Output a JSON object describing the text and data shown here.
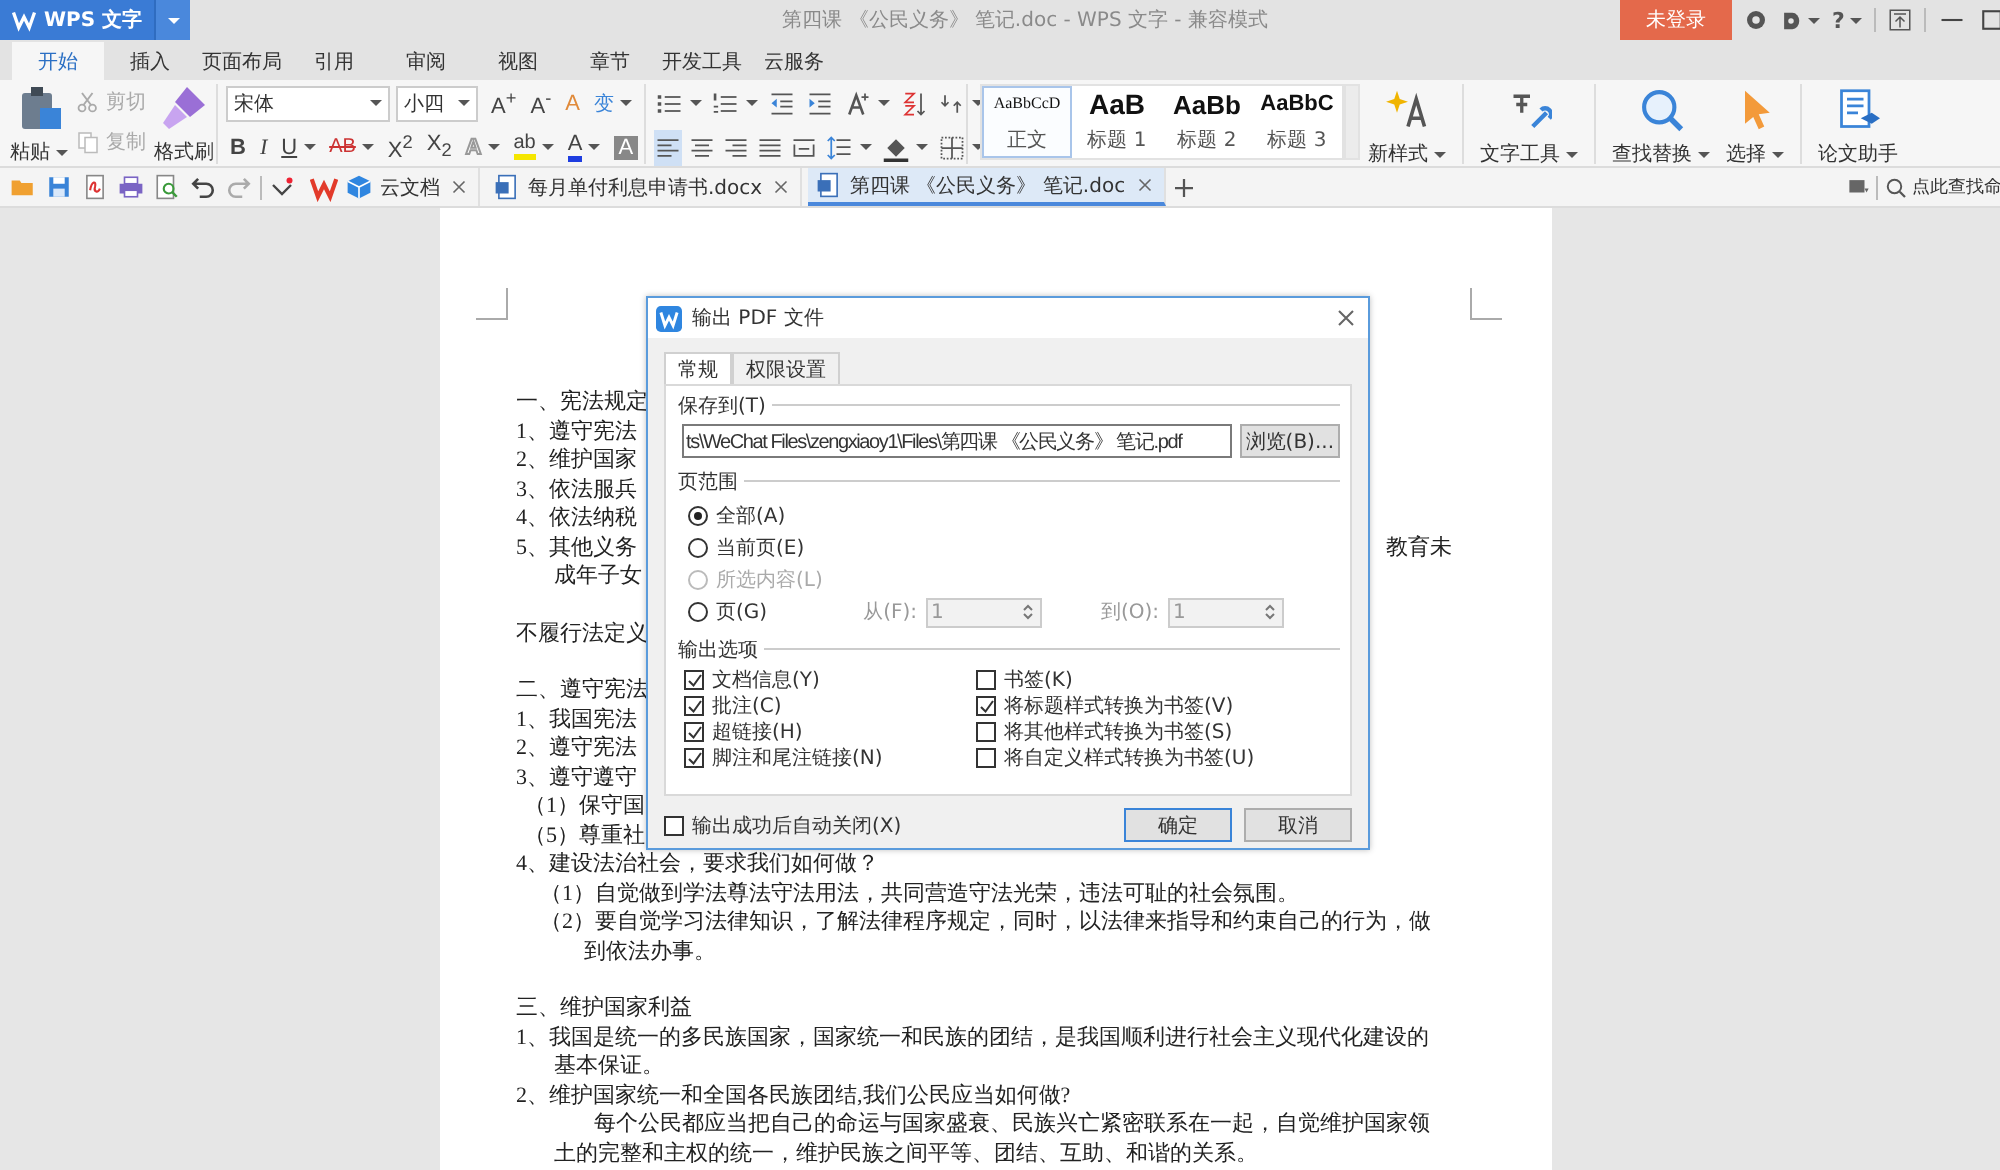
{
  "window": {
    "app_button": "WPS 文字",
    "title": "第四课 《公民义务》 笔记.doc - WPS 文字 - 兼容模式",
    "login_button": "未登录",
    "help_glyph": "?"
  },
  "ribbon_tabs": [
    {
      "label": "开始",
      "selected": true
    },
    {
      "label": "插入",
      "selected": false
    },
    {
      "label": "页面布局",
      "selected": false
    },
    {
      "label": "引用",
      "selected": false
    },
    {
      "label": "审阅",
      "selected": false
    },
    {
      "label": "视图",
      "selected": false
    },
    {
      "label": "章节",
      "selected": false
    },
    {
      "label": "开发工具",
      "selected": false
    },
    {
      "label": "云服务",
      "selected": false
    }
  ],
  "ribbon": {
    "paste": "粘贴",
    "cut": {
      "label": "剪切",
      "disabled": true
    },
    "copy": {
      "label": "复制",
      "disabled": true
    },
    "format_painter": "格式刷",
    "font_name": "宋体",
    "font_size": "小四",
    "font_row1": [
      {
        "glyph": "A$^{+}$",
        "kind": "plain",
        "dropdown": false
      },
      {
        "glyph": "A$^{-}$",
        "kind": "plain",
        "dropdown": false
      },
      {
        "glyph": "A",
        "kind": "clear",
        "dropdown": false
      },
      {
        "glyph": "变",
        "kind": "phonetic",
        "dropdown": true
      }
    ],
    "font_row2": [
      {
        "glyph": "B",
        "kind": "bold",
        "dropdown": false
      },
      {
        "glyph": "I",
        "kind": "italic",
        "dropdown": false
      },
      {
        "glyph": "U",
        "kind": "underline",
        "dropdown": true
      },
      {
        "glyph": "AB",
        "kind": "strike",
        "dropdown": true
      },
      {
        "glyph": "X$^{2}$",
        "kind": "plain",
        "dropdown": false
      },
      {
        "glyph": "X$_{2}$",
        "kind": "plain",
        "dropdown": false
      },
      {
        "glyph": "A",
        "kind": "outline",
        "dropdown": true
      },
      {
        "glyph": "ab",
        "kind": "highlight",
        "dropdown": true
      },
      {
        "glyph": "A",
        "kind": "color",
        "dropdown": true
      },
      {
        "glyph": "A",
        "kind": "shade",
        "dropdown": false
      }
    ],
    "align_buttons": [
      {
        "kind": "left",
        "selected": true
      },
      {
        "kind": "center",
        "selected": false
      },
      {
        "kind": "right",
        "selected": false
      },
      {
        "kind": "justify",
        "selected": false
      },
      {
        "kind": "distributed",
        "selected": false
      }
    ],
    "styles": [
      {
        "preview": "AaBbCcD",
        "label": "正文",
        "kind": "body",
        "selected": true
      },
      {
        "preview": "AaB",
        "label": "标题 1",
        "kind": "h1",
        "selected": false
      },
      {
        "preview": "AaBb",
        "label": "标题 2",
        "kind": "h2",
        "selected": false
      },
      {
        "preview": "AaBbC",
        "label": "标题 3",
        "kind": "h3",
        "selected": false
      }
    ],
    "tools": [
      {
        "label": "新样式",
        "kind": "new-style",
        "dropdown": true
      },
      {
        "label": "文字工具",
        "kind": "text-tools",
        "dropdown": true
      },
      {
        "label": "查找替换",
        "kind": "find",
        "dropdown": true
      },
      {
        "label": "选择",
        "kind": "select",
        "dropdown": true
      },
      {
        "label": "论文助手",
        "kind": "paper",
        "dropdown": false
      }
    ]
  },
  "doc_tabs": [
    {
      "label": "云文档",
      "kind": "cloud",
      "selected": false
    },
    {
      "label": "每月单付利息申请书.docx",
      "kind": "doc",
      "selected": false
    },
    {
      "label": "第四课 《公民义务》 笔记.doc",
      "kind": "doc",
      "selected": true
    }
  ],
  "command_search": {
    "placeholder": "点此查找命"
  },
  "document": {
    "lines": [
      {
        "text": "一、宪法规定",
        "kind": "section"
      },
      {
        "text": "1、遵守宪法",
        "kind": "item"
      },
      {
        "text": "2、维护国家",
        "kind": "item"
      },
      {
        "text": "3、依法服兵",
        "kind": "item"
      },
      {
        "text": "4、依法纳税",
        "kind": "item"
      },
      {
        "text": "5、其他义务",
        "tail": "教育未",
        "kind": "item"
      },
      {
        "text": "成年子女",
        "kind": "cont"
      },
      {
        "text": "不履行法定义",
        "kind": "note"
      },
      {
        "text": "二、遵守宪法",
        "kind": "section"
      },
      {
        "text": "1、我国宪法",
        "kind": "item"
      },
      {
        "text": "2、遵守宪法",
        "kind": "item"
      },
      {
        "text": "3、遵守遵守",
        "kind": "item"
      },
      {
        "text": "（1）保守国",
        "kind": "sub"
      },
      {
        "text": "（5）尊重社",
        "kind": "sub"
      },
      {
        "text": "4、建设法治社会，要求我们如何做？",
        "kind": "item"
      },
      {
        "text": "（1）自觉做到学法尊法守法用法，共同营造守法光荣，违法可耻的社会氛围。",
        "kind": "sub2"
      },
      {
        "text": "（2）要自觉学习法律知识，了解法律程序规定，同时，以法律来指导和约束自己的行为，做",
        "kind": "sub2"
      },
      {
        "text": "到依法办事。",
        "kind": "subcont"
      },
      {
        "text": "三、维护国家利益",
        "kind": "section"
      },
      {
        "text": "1、我国是统一的多民族国家，国家统一和民族的团结，是我国顺利进行社会主义现代化建设的",
        "kind": "item"
      },
      {
        "text": "基本保证。",
        "kind": "cont"
      },
      {
        "text": "2、维护国家统一和全国各民族团结,我们公民应当如何做?",
        "kind": "item"
      },
      {
        "text": "每个公民都应当把自己的命运与国家盛衰、民族兴亡紧密联系在一起，自觉维护国家领",
        "kind": "para"
      },
      {
        "text": "土的完整和主权的统一，维护民族之间平等、团结、互助、和谐的关系。",
        "kind": "cont"
      }
    ]
  },
  "dialog": {
    "title": "输出 PDF 文件",
    "tabs": [
      {
        "label": "常规",
        "selected": true
      },
      {
        "label": "权限设置",
        "selected": false
      }
    ],
    "save_to": {
      "label": "保存到(T)",
      "value": "ts\\WeChat Files\\zengxiaoy1\\Files\\第四课 《公民义务》 笔记.pdf",
      "browse": "浏览(B)..."
    },
    "page_range": {
      "label": "页范围",
      "options": [
        {
          "label": "全部(A)",
          "selected": true,
          "disabled": false
        },
        {
          "label": "当前页(E)",
          "selected": false,
          "disabled": false
        },
        {
          "label": "所选内容(L)",
          "selected": false,
          "disabled": true
        },
        {
          "label": "页(G)",
          "selected": false,
          "disabled": false
        }
      ],
      "from": {
        "label": "从(F):",
        "value": "1",
        "disabled": true
      },
      "to": {
        "label": "到(O):",
        "value": "1",
        "disabled": true
      }
    },
    "output_options": {
      "label": "输出选项",
      "items": [
        {
          "label": "文档信息(Y)",
          "checked": true
        },
        {
          "label": "书签(K)",
          "checked": false
        },
        {
          "label": "批注(C)",
          "checked": true
        },
        {
          "label": "将标题样式转换为书签(V)",
          "checked": true
        },
        {
          "label": "超链接(H)",
          "checked": true
        },
        {
          "label": "将其他样式转换为书签(S)",
          "checked": false
        },
        {
          "label": "脚注和尾注链接(N)",
          "checked": true
        },
        {
          "label": "将自定义样式转换为书签(U)",
          "checked": false
        }
      ]
    },
    "auto_close": {
      "label": "输出成功后自动关闭(X)",
      "checked": false
    },
    "buttons": [
      {
        "label": "确定",
        "kind": "primary"
      },
      {
        "label": "取消",
        "kind": "secondary"
      }
    ]
  }
}
